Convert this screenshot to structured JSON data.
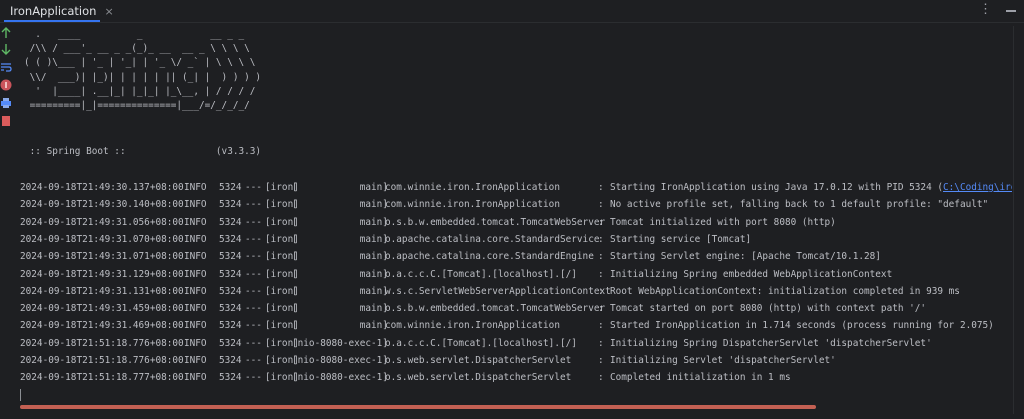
{
  "tab": {
    "title": "IronApplication",
    "close_glyph": "×",
    "icon": "run-console-icon"
  },
  "toolbar": {
    "more_glyph": "⋮",
    "minimize_icon": "minimize-icon"
  },
  "gutter_icons": [
    "rerun-up-icon",
    "scroll-down-icon",
    "soft-wrap-icon",
    "stop-icon",
    "print-icon",
    "clear-icon"
  ],
  "banner": "  .   ____          _            __ _ _\n /\\\\ / ___'_ __ _ _(_)_ __  __ _ \\ \\ \\ \\\n( ( )\\___ | '_ | '_| | '_ \\/ _` | \\ \\ \\ \\\n \\\\/  ___)| |_)| | | | | || (_| |  ) ) ) )\n  '  |____| .__|_| |_|_| |_\\__, | / / / /\n =========|_|==============|___/=/_/_/_/",
  "boot_line": " :: Spring Boot ::                (v3.3.3)",
  "logs": [
    {
      "time": "2024-09-18T21:49:30.137+08:00",
      "level": "INFO",
      "pid": "5324",
      "sep": "---",
      "app": "[iron]",
      "thread": "[           main]",
      "logger": "com.winnie.iron.IronApplication",
      "msg": "Starting IronApplication using Java 17.0.12 with PID 5324 (",
      "link": "C:\\Coding\\iron\\targ"
    },
    {
      "time": "2024-09-18T21:49:30.140+08:00",
      "level": "INFO",
      "pid": "5324",
      "sep": "---",
      "app": "[iron]",
      "thread": "[           main]",
      "logger": "com.winnie.iron.IronApplication",
      "msg": "No active profile set, falling back to 1 default profile: \"default\"",
      "link": ""
    },
    {
      "time": "2024-09-18T21:49:31.056+08:00",
      "level": "INFO",
      "pid": "5324",
      "sep": "---",
      "app": "[iron]",
      "thread": "[           main]",
      "logger": "o.s.b.w.embedded.tomcat.TomcatWebServer",
      "msg": "Tomcat initialized with port 8080 (http)",
      "link": ""
    },
    {
      "time": "2024-09-18T21:49:31.070+08:00",
      "level": "INFO",
      "pid": "5324",
      "sep": "---",
      "app": "[iron]",
      "thread": "[           main]",
      "logger": "o.apache.catalina.core.StandardService",
      "msg": "Starting service [Tomcat]",
      "link": ""
    },
    {
      "time": "2024-09-18T21:49:31.071+08:00",
      "level": "INFO",
      "pid": "5324",
      "sep": "---",
      "app": "[iron]",
      "thread": "[           main]",
      "logger": "o.apache.catalina.core.StandardEngine",
      "msg": "Starting Servlet engine: [Apache Tomcat/10.1.28]",
      "link": ""
    },
    {
      "time": "2024-09-18T21:49:31.129+08:00",
      "level": "INFO",
      "pid": "5324",
      "sep": "---",
      "app": "[iron]",
      "thread": "[           main]",
      "logger": "o.a.c.c.C.[Tomcat].[localhost].[/]",
      "msg": "Initializing Spring embedded WebApplicationContext",
      "link": ""
    },
    {
      "time": "2024-09-18T21:49:31.131+08:00",
      "level": "INFO",
      "pid": "5324",
      "sep": "---",
      "app": "[iron]",
      "thread": "[           main]",
      "logger": "w.s.c.ServletWebServerApplicationContext",
      "msg": "Root WebApplicationContext: initialization completed in 939 ms",
      "link": ""
    },
    {
      "time": "2024-09-18T21:49:31.459+08:00",
      "level": "INFO",
      "pid": "5324",
      "sep": "---",
      "app": "[iron]",
      "thread": "[           main]",
      "logger": "o.s.b.w.embedded.tomcat.TomcatWebServer",
      "msg": "Tomcat started on port 8080 (http) with context path '/'",
      "link": ""
    },
    {
      "time": "2024-09-18T21:49:31.469+08:00",
      "level": "INFO",
      "pid": "5324",
      "sep": "---",
      "app": "[iron]",
      "thread": "[           main]",
      "logger": "com.winnie.iron.IronApplication",
      "msg": "Started IronApplication in 1.714 seconds (process running for 2.075)",
      "link": ""
    },
    {
      "time": "2024-09-18T21:51:18.776+08:00",
      "level": "INFO",
      "pid": "5324",
      "sep": "---",
      "app": "[iron]",
      "thread": "[nio-8080-exec-1]",
      "logger": "o.a.c.c.C.[Tomcat].[localhost].[/]",
      "msg": "Initializing Spring DispatcherServlet 'dispatcherServlet'",
      "link": ""
    },
    {
      "time": "2024-09-18T21:51:18.776+08:00",
      "level": "INFO",
      "pid": "5324",
      "sep": "---",
      "app": "[iron]",
      "thread": "[nio-8080-exec-1]",
      "logger": "o.s.web.servlet.DispatcherServlet",
      "msg": "Initializing Servlet 'dispatcherServlet'",
      "link": ""
    },
    {
      "time": "2024-09-18T21:51:18.777+08:00",
      "level": "INFO",
      "pid": "5324",
      "sep": "---",
      "app": "[iron]",
      "thread": "[nio-8080-exec-1]",
      "logger": "o.s.web.servlet.DispatcherServlet",
      "msg": "Completed initialization in 1 ms",
      "link": ""
    }
  ],
  "colors": {
    "background": "#1e1f22",
    "text": "#bcbec4",
    "link": "#548af7",
    "tab_accent": "#3574f0",
    "scrollbar": "#e06c5c"
  }
}
